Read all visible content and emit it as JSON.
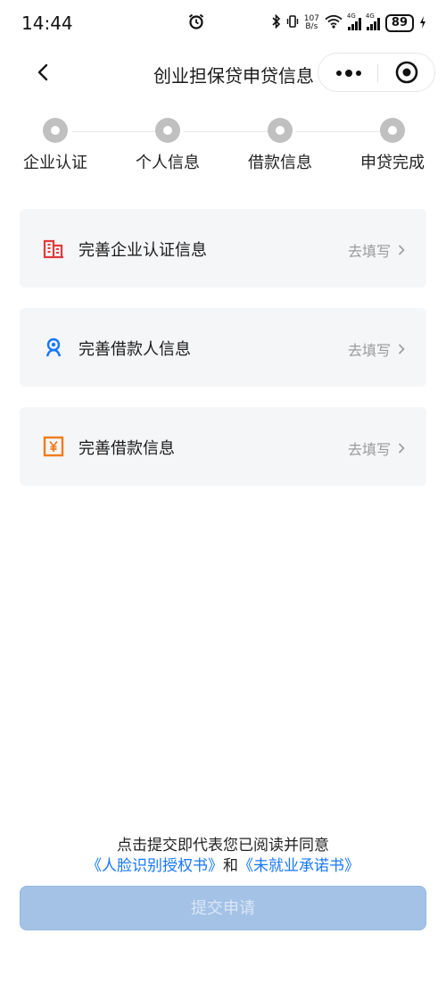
{
  "status_bar": {
    "time": "14:44",
    "net_speed_value": "107",
    "net_speed_unit": "B/s",
    "sim1_tag": "4G",
    "sim2_tag": "4G",
    "battery": "89",
    "icons": [
      "alarm-icon",
      "bluetooth-icon",
      "vibrate-icon",
      "wifi-icon",
      "signal-icon",
      "battery-icon"
    ]
  },
  "nav": {
    "title": "创业担保贷申贷信息",
    "icons": [
      "back-icon",
      "more-icon",
      "close-target-icon"
    ]
  },
  "steps": [
    {
      "label": "企业认证"
    },
    {
      "label": "个人信息"
    },
    {
      "label": "借款信息"
    },
    {
      "label": "申贷完成"
    }
  ],
  "cards": [
    {
      "title": "完善企业认证信息",
      "action": "去填写",
      "icon": "building-icon",
      "color": "#e03a3e"
    },
    {
      "title": "完善借款人信息",
      "action": "去填写",
      "icon": "person-badge-icon",
      "color": "#1677ff"
    },
    {
      "title": "完善借款信息",
      "action": "去填写",
      "icon": "yen-icon",
      "color": "#f07c1a"
    }
  ],
  "footer": {
    "agreement_text": "点击提交即代表您已阅读并同意",
    "link_1": "《人脸识别授权书》",
    "conjunction": "和",
    "link_2": "《未就业承诺书》",
    "submit_label": "提交申请"
  },
  "colors": {
    "link": "#1677ff",
    "submit_bg": "#a3c2e6",
    "card_bg": "#f5f6f8"
  }
}
